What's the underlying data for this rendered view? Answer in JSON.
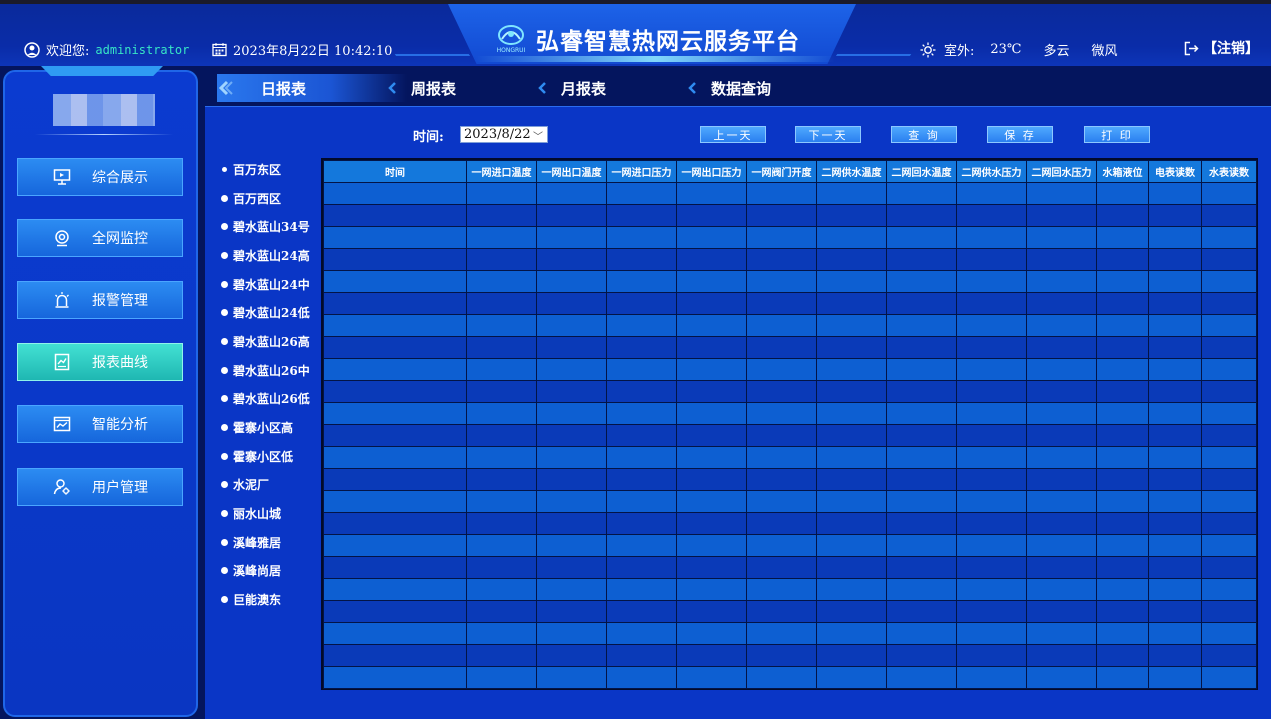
{
  "header": {
    "title": "弘睿智慧热网云服务平台",
    "welcome_label": "欢迎您:",
    "username": "administrator",
    "datetime": "2023年8月22日 10:42:10",
    "weather": {
      "label": "室外:",
      "temp": "23℃",
      "condition": "多云",
      "wind": "微风"
    },
    "logout_label": "【注销】",
    "logo_text": "HONGRUI"
  },
  "sidebar": {
    "items": [
      {
        "label": "综合展示",
        "icon": "presentation-icon"
      },
      {
        "label": "全网监控",
        "icon": "webcam-icon"
      },
      {
        "label": "报警管理",
        "icon": "alarm-light-icon"
      },
      {
        "label": "报表曲线",
        "icon": "chart-document-icon",
        "active": true
      },
      {
        "label": "智能分析",
        "icon": "analytics-window-icon"
      },
      {
        "label": "用户管理",
        "icon": "user-gear-icon"
      }
    ]
  },
  "tabs": [
    "日报表",
    "周报表",
    "月报表",
    "数据查询"
  ],
  "toolbar": {
    "time_label": "时间:",
    "date_value": "2023/8/22",
    "prev_day": "上一天",
    "next_day": "下一天",
    "query": "查 询",
    "save": "保 存",
    "print": "打 印"
  },
  "stations": [
    "百万东区",
    "百万西区",
    "碧水蓝山34号",
    "碧水蓝山24高",
    "碧水蓝山24中",
    "碧水蓝山24低",
    "碧水蓝山26高",
    "碧水蓝山26中",
    "碧水蓝山26低",
    "霍寨小区高",
    "霍寨小区低",
    "水泥厂",
    "丽水山城",
    "溪峰雅居",
    "溪峰尚居",
    "巨能澳东"
  ],
  "table": {
    "columns": [
      "时间",
      "一网进口温度",
      "一网出口温度",
      "一网进口压力",
      "一网出口压力",
      "一网阀门开度",
      "二网供水温度",
      "二网回水温度",
      "二网供水压力",
      "二网回水压力",
      "水箱液位",
      "电表读数",
      "水表读数"
    ],
    "row_count": 23
  },
  "colors": {
    "accent": "#1478dc",
    "active_nav": "#2fc6c0",
    "panel": "#0a36c6"
  }
}
